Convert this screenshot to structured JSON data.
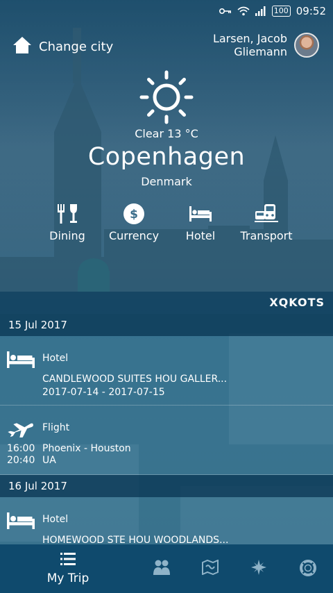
{
  "status_bar": {
    "battery": "100",
    "time": "09:52"
  },
  "header": {
    "change_city_label": "Change city",
    "user_name_line1": "Larsen, Jacob",
    "user_name_line2": "Gliemann"
  },
  "weather": {
    "condition": "Clear 13 °C",
    "city": "Copenhagen",
    "country": "Denmark"
  },
  "quick_actions": [
    {
      "label": "Dining",
      "icon": "cutlery-icon"
    },
    {
      "label": "Currency",
      "icon": "dollar-icon"
    },
    {
      "label": "Hotel",
      "icon": "bed-icon"
    },
    {
      "label": "Transport",
      "icon": "train-icon"
    }
  ],
  "trip_code": "XQKOTS",
  "itinerary": {
    "day1": {
      "date": "15 Jul 2017",
      "hotel": {
        "type": "Hotel",
        "name": "CANDLEWOOD SUITES HOU GALLER...",
        "dates": "2017-07-14 - 2017-07-15"
      },
      "flight": {
        "type": "Flight",
        "dep_time": "16:00",
        "arr_time": "20:40",
        "route": "Phoenix - Houston",
        "carrier": "UA"
      }
    },
    "day2": {
      "date": "16 Jul 2017",
      "hotel": {
        "type": "Hotel",
        "name": "HOMEWOOD STE HOU WOODLANDS..."
      }
    }
  },
  "bottom_nav": {
    "my_trip_label": "My Trip"
  },
  "colors": {
    "nav_bg": "#0f4a6d",
    "bar_bg": "#0e3e5c"
  }
}
